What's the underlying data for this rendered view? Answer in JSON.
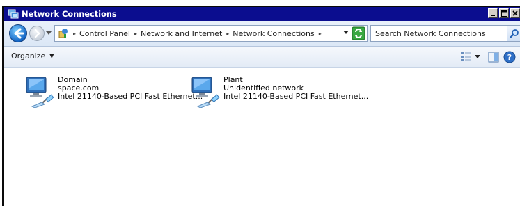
{
  "window": {
    "title": "Network Connections",
    "caption_buttons": {
      "minimize": "_",
      "maximize": "□",
      "close": "x"
    }
  },
  "address": {
    "crumbs": [
      "Control Panel",
      "Network and Internet",
      "Network Connections"
    ],
    "separator": "▸"
  },
  "search": {
    "placeholder": "Search Network Connections"
  },
  "toolbar": {
    "organize_label": "Organize",
    "organize_arrow": "▼"
  },
  "connections": [
    {
      "name": "Domain",
      "network": "space.com",
      "adapter": "Intel 21140-Based PCI Fast Ethernet..."
    },
    {
      "name": "Plant",
      "network": "Unidentified network",
      "adapter": "Intel 21140-Based PCI Fast Ethernet..."
    }
  ],
  "icons": {
    "back": "back-arrow-icon",
    "forward": "forward-arrow-icon",
    "control_panel": "control-panel-icon",
    "refresh": "refresh-icon",
    "search": "magnifier-icon",
    "views": "views-icon",
    "preview": "preview-pane-icon",
    "help": "help-icon",
    "network_adapter": "network-adapter-icon"
  },
  "colors": {
    "titlebar": "#0b0d8f",
    "address_bg": "#e9f1fb",
    "back_button": "#1466c6"
  }
}
